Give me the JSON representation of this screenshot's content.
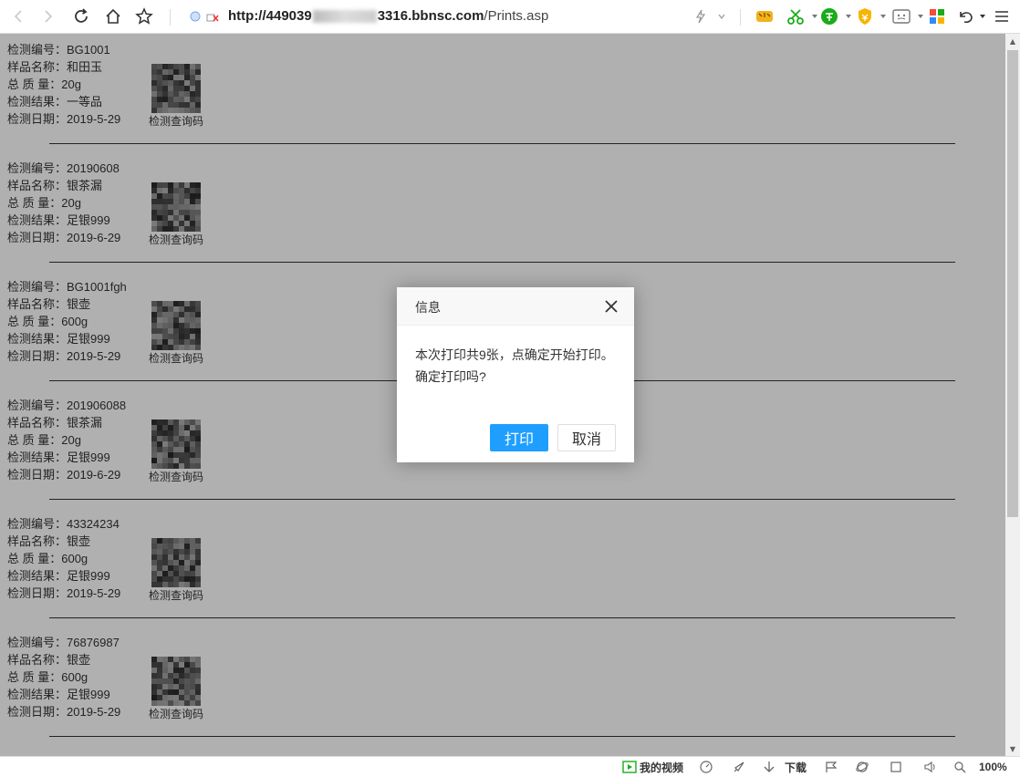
{
  "browser": {
    "url_host_prefix": "http://44903",
    "url_host_bold": "9",
    "url_host_suffix": "3316.bbnsc.com",
    "url_path": "/Prints.asp",
    "zoom": "100%",
    "status_items": {
      "video": "我的视频",
      "download": "下载"
    }
  },
  "records": [
    {
      "id_label": "检测编号：",
      "id": "BG1001",
      "name_label": "样品名称：",
      "name": "和田玉",
      "weight_label": "总 质 量：",
      "weight": "20g",
      "result_label": "检测结果：",
      "result": "一等品",
      "date_label": "检测日期：",
      "date": "2019-5-29",
      "qr_label": "检测查询码"
    },
    {
      "id_label": "检测编号：",
      "id": "20190608",
      "name_label": "样品名称：",
      "name": "银茶漏",
      "weight_label": "总 质 量：",
      "weight": "20g",
      "result_label": "检测结果：",
      "result": "足银999",
      "date_label": "检测日期：",
      "date": "2019-6-29",
      "qr_label": "检测查询码"
    },
    {
      "id_label": "检测编号：",
      "id": "BG1001fgh",
      "name_label": "样品名称：",
      "name": "银壶",
      "weight_label": "总 质 量：",
      "weight": "600g",
      "result_label": "检测结果：",
      "result": "足银999",
      "date_label": "检测日期：",
      "date": "2019-5-29",
      "qr_label": "检测查询码"
    },
    {
      "id_label": "检测编号：",
      "id": "201906088",
      "name_label": "样品名称：",
      "name": "银茶漏",
      "weight_label": "总 质 量：",
      "weight": "20g",
      "result_label": "检测结果：",
      "result": "足银999",
      "date_label": "检测日期：",
      "date": "2019-6-29",
      "qr_label": "检测查询码"
    },
    {
      "id_label": "检测编号：",
      "id": "43324234",
      "name_label": "样品名称：",
      "name": "银壶",
      "weight_label": "总 质 量：",
      "weight": "600g",
      "result_label": "检测结果：",
      "result": "足银999",
      "date_label": "检测日期：",
      "date": "2019-5-29",
      "qr_label": "检测查询码"
    },
    {
      "id_label": "检测编号：",
      "id": "76876987",
      "name_label": "样品名称：",
      "name": "银壶",
      "weight_label": "总 质 量：",
      "weight": "600g",
      "result_label": "检测结果：",
      "result": "足银999",
      "date_label": "检测日期：",
      "date": "2019-5-29",
      "qr_label": "检测查询码"
    }
  ],
  "dialog": {
    "title": "信息",
    "message_line1": "本次打印共9张，点确定开始打印。",
    "message_line2": "确定打印吗?",
    "ok_label": "打印",
    "cancel_label": "取消"
  },
  "icons": [
    "back-icon",
    "forward-icon",
    "refresh-icon",
    "home-icon",
    "star-icon",
    "lightning-icon",
    "extension-icons",
    "undo-icon",
    "menu-icon"
  ]
}
